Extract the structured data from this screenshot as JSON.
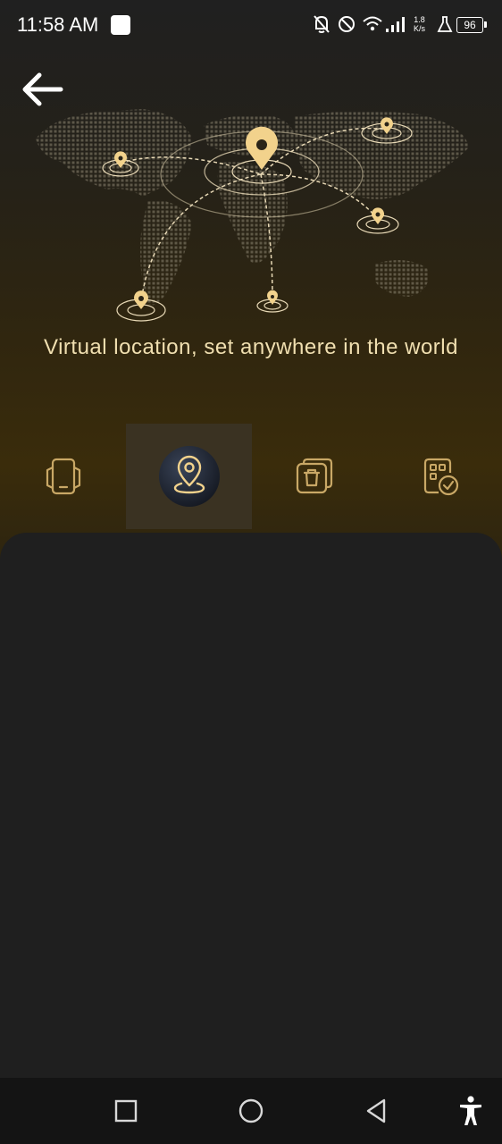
{
  "status_bar": {
    "time": "11:58 AM",
    "net_speed_value": "1.8",
    "net_speed_unit": "K/s",
    "battery": "96",
    "icons": [
      "bell-off-icon",
      "dnd-icon",
      "wifi-icon",
      "signal-icon",
      "flask-icon"
    ]
  },
  "header": {
    "back_icon": "arrow-left-icon"
  },
  "hero": {
    "illustration": "world-map-location-pins",
    "tagline": "Virtual location, set anywhere in the world"
  },
  "tabs": [
    {
      "id": "device",
      "icon": "phone-icon",
      "active": false
    },
    {
      "id": "location",
      "icon": "location-pin-icon",
      "active": true
    },
    {
      "id": "clean",
      "icon": "trash-icon",
      "active": false
    },
    {
      "id": "verify",
      "icon": "check-card-icon",
      "active": false
    }
  ],
  "nav_bar": {
    "icons": [
      "recents-square-icon",
      "home-circle-icon",
      "back-triangle-icon",
      "accessibility-icon"
    ]
  },
  "colors": {
    "accent": "#f2d28c",
    "icon_tint": "#c9a866",
    "background": "#202020"
  }
}
